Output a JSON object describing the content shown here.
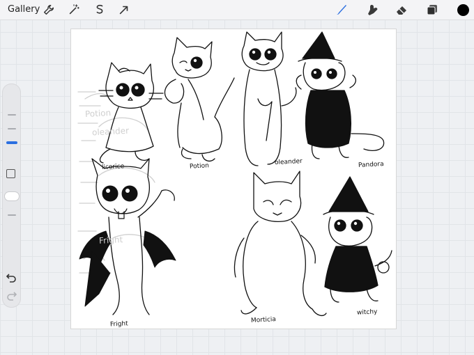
{
  "toolbar": {
    "gallery_label": "Gallery",
    "left_icons": [
      "wrench-icon",
      "magic-wand-icon",
      "selection-icon",
      "transform-arrow-icon"
    ],
    "right_icons": [
      "brush-icon",
      "smudge-icon",
      "eraser-icon",
      "layers-icon",
      "color-swatch"
    ],
    "active_tool": "brush",
    "accent_color": "#2b6fe0",
    "current_color": "#000000"
  },
  "sidebar": {
    "controls": [
      "brush-size-slider",
      "modify-button",
      "brush-opacity-slider",
      "undo-button",
      "redo-button"
    ]
  },
  "canvas": {
    "character_labels": [
      "licorice",
      "Potion",
      "oleander",
      "Pandora",
      "Fright",
      "Morticia",
      "witchy"
    ],
    "faint_sketch_labels": [
      "Potion",
      "oleander",
      "Fright"
    ]
  }
}
